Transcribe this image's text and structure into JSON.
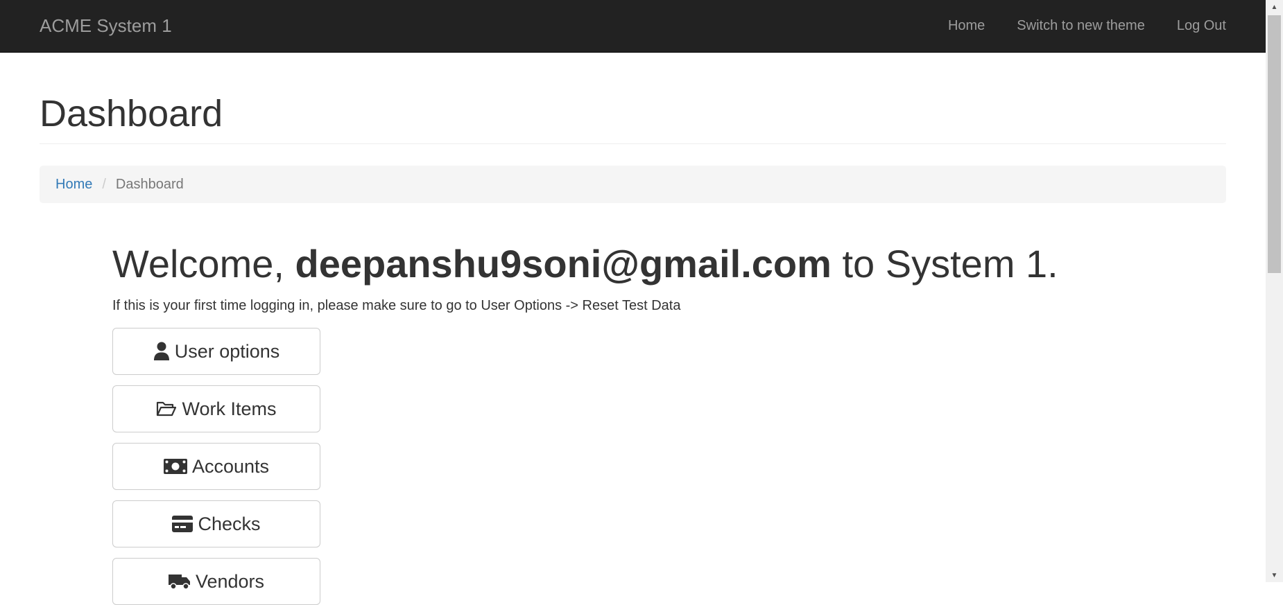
{
  "navbar": {
    "brand": "ACME System 1",
    "links": [
      "Home",
      "Switch to new theme",
      "Log Out"
    ]
  },
  "header": {
    "title": "Dashboard"
  },
  "breadcrumb": {
    "home": "Home",
    "separator": "/",
    "current": "Dashboard"
  },
  "welcome": {
    "prefix": "Welcome, ",
    "user": "deepanshu9soni@gmail.com",
    "suffix": " to System 1."
  },
  "intro_text": "If this is your first time logging in, please make sure to go to User Options -> Reset Test Data",
  "menu": [
    {
      "label": "User options",
      "icon": "user-icon"
    },
    {
      "label": "Work Items",
      "icon": "folder-open-icon"
    },
    {
      "label": "Accounts",
      "icon": "money-bill-icon"
    },
    {
      "label": "Checks",
      "icon": "credit-card-icon"
    },
    {
      "label": "Vendors",
      "icon": "truck-icon"
    }
  ],
  "colors": {
    "navbar_bg": "#222222",
    "navbar_text": "#9d9d9d",
    "link": "#337ab7",
    "breadcrumb_bg": "#f5f5f5"
  }
}
